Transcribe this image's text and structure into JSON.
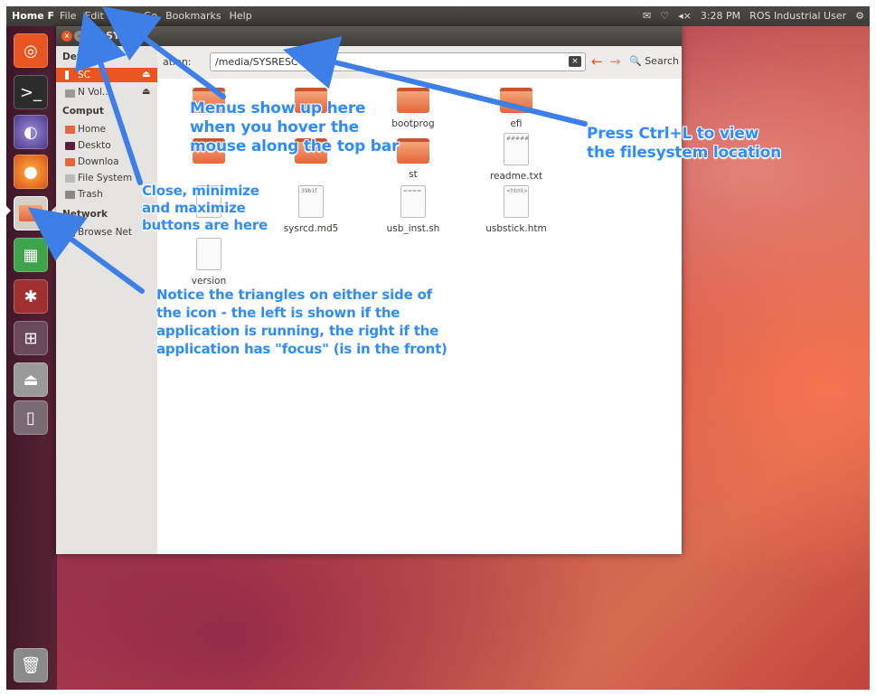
{
  "top_panel": {
    "app_name": "Home F",
    "menus": [
      "File",
      "Edit",
      "View",
      "Go",
      "Bookmarks",
      "Help"
    ],
    "indicators": {
      "mail": "✉",
      "network": "♡",
      "volume": "◂×",
      "time": "3:28 PM",
      "user": "ROS Industrial User",
      "session": "⚙"
    }
  },
  "window": {
    "title": "SYS",
    "buttons": {
      "close": "×",
      "minimize": "–",
      "maximize": "□"
    },
    "location_label": "ation:",
    "location_value": "/media/SYSRESC",
    "search_label": "Search"
  },
  "sidebar": {
    "sections": [
      {
        "heading": "Devices",
        "items": [
          {
            "label": "SC",
            "selected": true,
            "eject": true
          },
          {
            "label": "N      Vol...",
            "eject": true
          }
        ]
      },
      {
        "heading": "Comput",
        "items": [
          {
            "label": "Home"
          },
          {
            "label": "Deskto"
          },
          {
            "label": "Downloa"
          },
          {
            "label": "File System"
          },
          {
            "label": "Trash"
          }
        ]
      },
      {
        "heading": "Network",
        "items": [
          {
            "label": "Browse Net"
          }
        ]
      }
    ]
  },
  "files": [
    {
      "name": "",
      "type": "folder"
    },
    {
      "name": "",
      "type": "folder"
    },
    {
      "name": "bootprog",
      "type": "folder"
    },
    {
      "name": "efi",
      "type": "folder"
    },
    {
      "name": "",
      "type": "folder"
    },
    {
      "name": "",
      "type": "folder"
    },
    {
      "name": "st",
      "type": "folder"
    },
    {
      "name": "readme.txt",
      "type": "doc"
    },
    {
      "name": "",
      "type": "doc"
    },
    {
      "name": "sysrcd.md5",
      "type": "doc"
    },
    {
      "name": "usb_inst.sh",
      "type": "doc"
    },
    {
      "name": "usbstick.htm",
      "type": "doc"
    },
    {
      "name": "version",
      "type": "doc"
    }
  ],
  "annotations": {
    "menus": "Menus show up here\nwhen you hover the\nmouse along the top bar",
    "ctrl_l": "Press Ctrl+L to view\nthe filesystem location",
    "buttons": "Close, minimize\nand maximize\nbuttons are here",
    "triangles": "Notice the triangles on either side of\nthe icon - the left is shown if the\napplication is running, the right if the\napplication has \"focus\" (is in the front)"
  },
  "colors": {
    "accent": "#e95420",
    "annotation": "#2f8cff",
    "panel": "#3c3b37"
  }
}
